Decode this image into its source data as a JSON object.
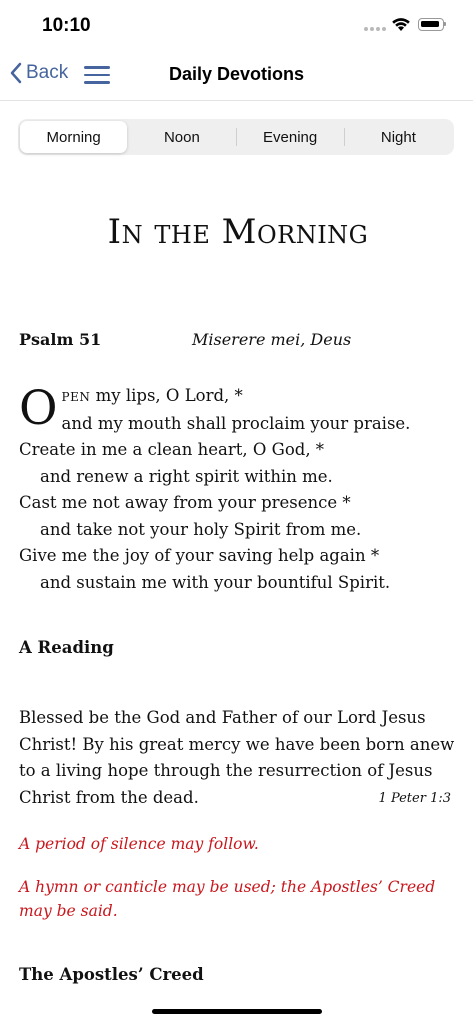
{
  "status_bar": {
    "time": "10:10"
  },
  "nav": {
    "back_label": "Back",
    "title": "Daily Devotions"
  },
  "segments": [
    {
      "label": "Morning",
      "selected": true
    },
    {
      "label": "Noon",
      "selected": false
    },
    {
      "label": "Evening",
      "selected": false
    },
    {
      "label": "Night",
      "selected": false
    }
  ],
  "content": {
    "office_title": "In the Morning",
    "psalm": {
      "number": "Psalm 51",
      "latin": "Miserere mei, Deus",
      "dropcap": "O",
      "first_word_rest": "PEN",
      "first_line_rest": " my lips, O Lord, *",
      "lines": [
        "and my mouth shall proclaim your praise.",
        "Create in me a clean heart, O God, *",
        "and renew a right spirit within me.",
        "Cast me not away from your presence *",
        "and take not your holy Spirit from me.",
        "Give me the joy of your saving help again *",
        "and sustain me with your bountiful Spirit."
      ]
    },
    "reading_heading": "A Reading",
    "reading_text": "Blessed be the God and Father of our Lord Jesus Christ! By his great mercy we have been born anew to a living hope through the resurrection of Jesus Christ from the dead.",
    "reading_citation": "1 Peter 1:3",
    "rubric_1": "A period of silence may follow.",
    "rubric_2": "A hymn or canticle may be used; the Apostles’ Creed may be said.",
    "creed_heading": "The Apostles’ Creed"
  },
  "colors": {
    "accent": "#46649d",
    "rubric": "#c8171d"
  }
}
